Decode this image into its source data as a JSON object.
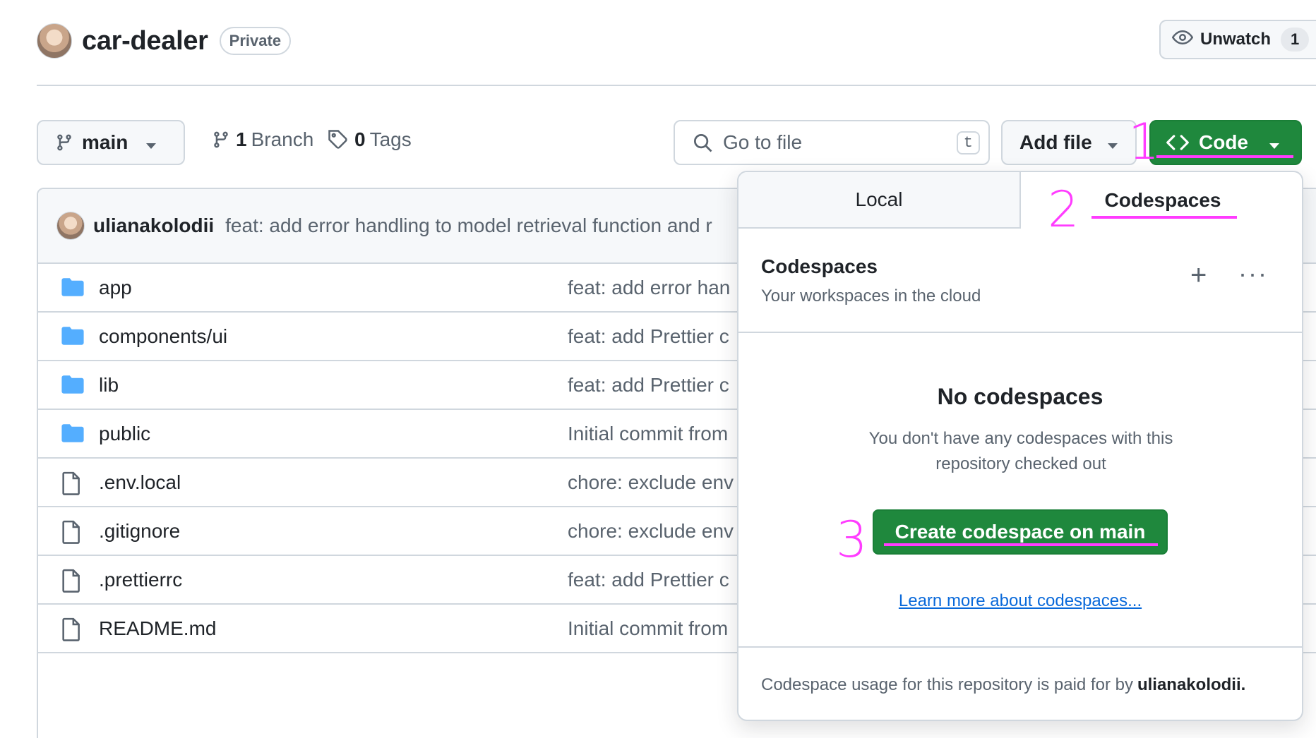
{
  "repo": {
    "name": "car-dealer",
    "visibility": "Private"
  },
  "watch": {
    "label": "Unwatch",
    "count": "1"
  },
  "toolbar": {
    "branch": "main",
    "branches_count": "1",
    "branches_label": "Branch",
    "tags_count": "0",
    "tags_label": "Tags",
    "goto_placeholder": "Go to file",
    "goto_shortcut": "t",
    "add_file": "Add file",
    "code": "Code"
  },
  "latest_commit": {
    "author": "ulianakolodii",
    "message": "feat: add error handling to model retrieval function and r"
  },
  "files": [
    {
      "name": "app",
      "type": "folder",
      "commit": "feat: add error han"
    },
    {
      "name": "components/ui",
      "type": "folder",
      "commit": "feat: add Prettier c"
    },
    {
      "name": "lib",
      "type": "folder",
      "commit": "feat: add Prettier c"
    },
    {
      "name": "public",
      "type": "folder",
      "commit": "Initial commit from"
    },
    {
      "name": ".env.local",
      "type": "file",
      "commit": "chore: exclude env"
    },
    {
      "name": ".gitignore",
      "type": "file",
      "commit": "chore: exclude env"
    },
    {
      "name": ".prettierrc",
      "type": "file",
      "commit": "feat: add Prettier c"
    },
    {
      "name": "README.md",
      "type": "file",
      "commit": "Initial commit from"
    }
  ],
  "panel": {
    "tabs": [
      "Local",
      "Codespaces"
    ],
    "title": "Codespaces",
    "subtitle": "Your workspaces in the cloud",
    "empty_title": "No codespaces",
    "empty_desc": "You don't have any codespaces with this repository checked out",
    "create_button": "Create codespace on main",
    "learn_link": "Learn more about codespaces...",
    "footer_prefix": "Codespace usage for this repository is paid for by",
    "footer_user": "ulianakolodii."
  },
  "annotations": [
    "1",
    "2",
    "3"
  ],
  "colors": {
    "primary": "#1f883d",
    "annotation": "#ff3cff",
    "link": "#0969da",
    "folder": "#54aeff"
  },
  "icons": {
    "avatar": "user-avatar",
    "eye": "eye-icon",
    "branch": "git-branch-icon",
    "tag": "tag-icon",
    "search": "search-icon",
    "code": "code-icon",
    "folder": "folder-icon",
    "file": "file-icon",
    "plus": "plus-icon",
    "more": "kebab-horizontal-icon"
  }
}
